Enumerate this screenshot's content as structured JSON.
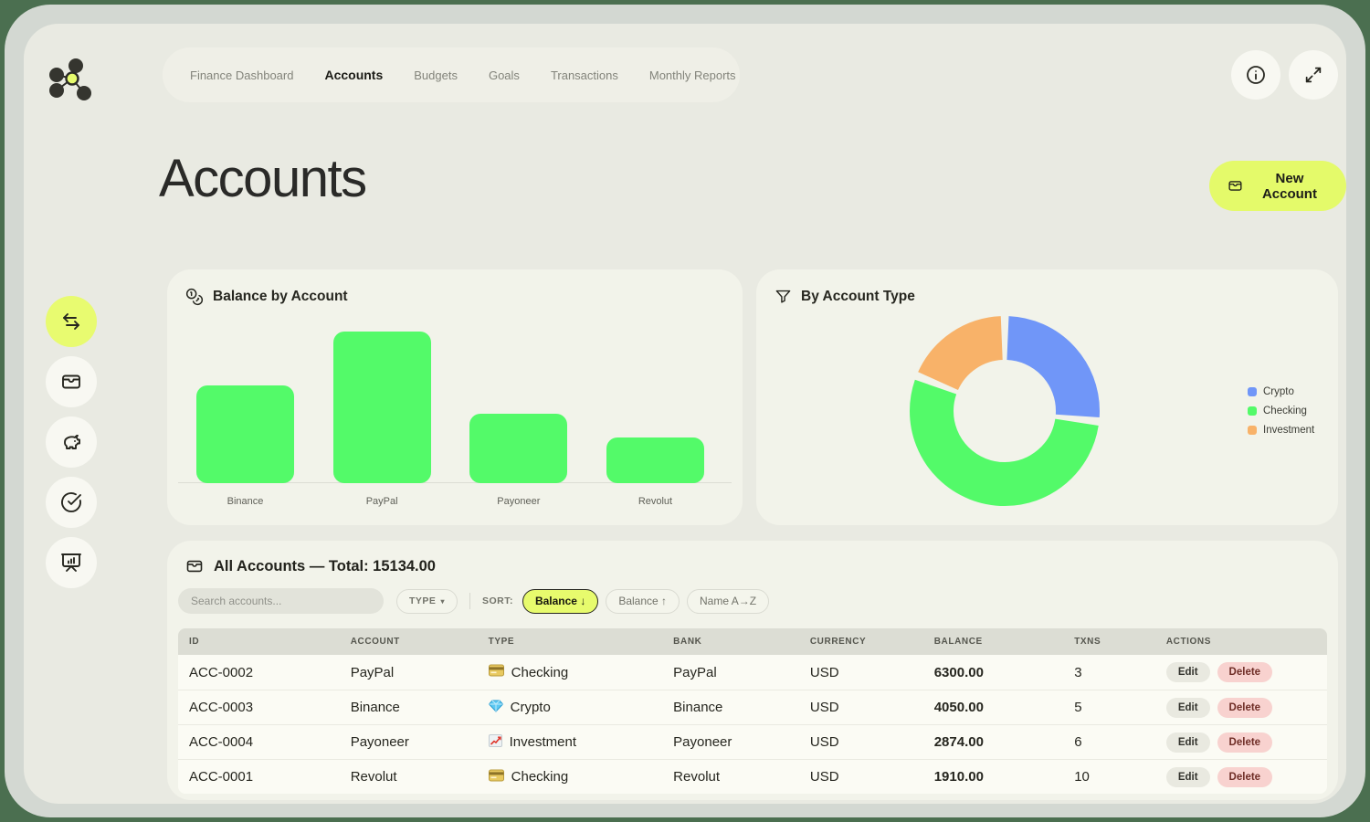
{
  "brand": {
    "logo_icon": "molecule-icon"
  },
  "nav": {
    "items": [
      {
        "label": "Finance Dashboard",
        "active": false
      },
      {
        "label": "Accounts",
        "active": true
      },
      {
        "label": "Budgets",
        "active": false
      },
      {
        "label": "Goals",
        "active": false
      },
      {
        "label": "Transactions",
        "active": false
      },
      {
        "label": "Monthly Reports",
        "active": false
      }
    ]
  },
  "header_actions": {
    "info_icon": "info-icon",
    "fullscreen_icon": "expand-icon"
  },
  "page": {
    "title": "Accounts"
  },
  "actions": {
    "new_account_label": "New Account",
    "new_account_icon": "wallet-icon"
  },
  "sidebar": {
    "items": [
      {
        "icon": "transfer-arrows-icon",
        "name": "transactions",
        "active": true
      },
      {
        "icon": "wallet-icon",
        "name": "accounts",
        "active": false
      },
      {
        "icon": "piggy-bank-icon",
        "name": "budgets",
        "active": false
      },
      {
        "icon": "goal-target-icon",
        "name": "goals",
        "active": false
      },
      {
        "icon": "presentation-chart-icon",
        "name": "reports",
        "active": false
      }
    ]
  },
  "chart_data": [
    {
      "type": "bar",
      "title": "Balance by Account",
      "header_icon": "coins-icon",
      "categories": [
        "Binance",
        "PayPal",
        "Payoneer",
        "Revolut"
      ],
      "values": [
        4050,
        6300,
        2874,
        1910
      ],
      "ylim": [
        0,
        6300
      ],
      "grid": false,
      "bar_color": "#53fa69"
    },
    {
      "type": "donut",
      "title": "By Account Type",
      "header_icon": "funnel-icon",
      "labels": [
        "Crypto",
        "Checking",
        "Investment"
      ],
      "values": [
        4050,
        8210,
        2874
      ],
      "colors": [
        "#7096f8",
        "#53fa69",
        "#f8b269"
      ],
      "legend_position": "right"
    }
  ],
  "accounts_section": {
    "header_icon": "wallet-icon",
    "title": "All Accounts — Total: 15134.00",
    "search_placeholder": "Search accounts...",
    "type_filter": {
      "label": "TYPE",
      "caret": "▾"
    },
    "sort_label": "SORT:",
    "sort_options": [
      {
        "label": "Balance ↓",
        "active": true
      },
      {
        "label": "Balance ↑",
        "active": false
      },
      {
        "label": "Name A→Z",
        "active": false
      }
    ],
    "columns": [
      "ID",
      "ACCOUNT",
      "TYPE",
      "BANK",
      "CURRENCY",
      "BALANCE",
      "TXNS",
      "ACTIONS"
    ],
    "rows": [
      {
        "id": "ACC-0002",
        "account": "PayPal",
        "type": "Checking",
        "type_icon": "card-icon",
        "bank": "PayPal",
        "currency": "USD",
        "balance": "6300.00",
        "txns": "3"
      },
      {
        "id": "ACC-0003",
        "account": "Binance",
        "type": "Crypto",
        "type_icon": "gem-icon",
        "bank": "Binance",
        "currency": "USD",
        "balance": "4050.00",
        "txns": "5"
      },
      {
        "id": "ACC-0004",
        "account": "Payoneer",
        "type": "Investment",
        "type_icon": "chart-up-icon",
        "bank": "Payoneer",
        "currency": "USD",
        "balance": "2874.00",
        "txns": "6"
      },
      {
        "id": "ACC-0001",
        "account": "Revolut",
        "type": "Checking",
        "type_icon": "card-icon",
        "bank": "Revolut",
        "currency": "USD",
        "balance": "1910.00",
        "txns": "10"
      }
    ],
    "row_actions": {
      "edit": "Edit",
      "delete": "Delete"
    }
  },
  "colors": {
    "accent_yellow": "#e6fb6d",
    "bar_green": "#53fa69",
    "donut_blue": "#7096f8",
    "donut_orange": "#f8b269",
    "frame_green": "#4b6f50",
    "app_background": "#e9eae2",
    "card_background": "#f2f3ea"
  }
}
